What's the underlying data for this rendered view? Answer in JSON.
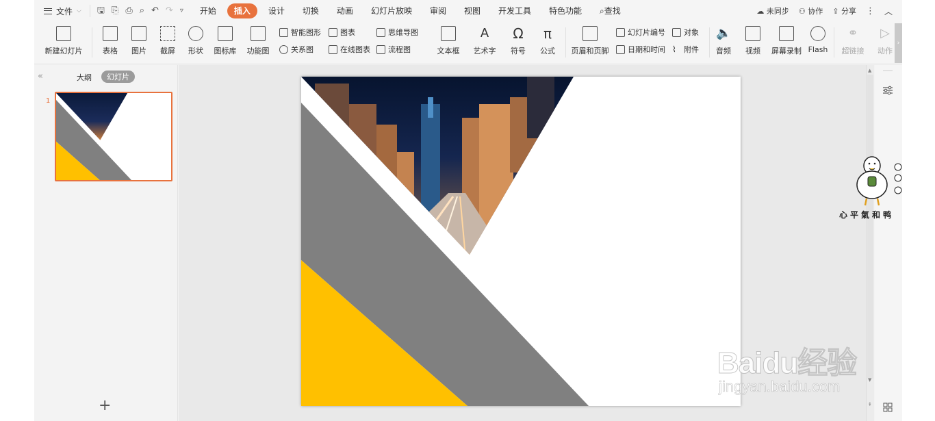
{
  "menubar": {
    "file_label": "文件",
    "tabs": [
      {
        "label": "开始"
      },
      {
        "label": "插入"
      },
      {
        "label": "设计"
      },
      {
        "label": "切换"
      },
      {
        "label": "动画"
      },
      {
        "label": "幻灯片放映"
      },
      {
        "label": "审阅"
      },
      {
        "label": "视图"
      },
      {
        "label": "开发工具"
      },
      {
        "label": "特色功能"
      }
    ],
    "search_label": "查找",
    "sync_label": "未同步",
    "collab_label": "协作",
    "share_label": "分享"
  },
  "ribbon": {
    "new_slide": "新建幻灯片",
    "table": "表格",
    "picture": "图片",
    "screenshot": "截屏",
    "shape": "形状",
    "icon_lib": "图标库",
    "func_chart": "功能图",
    "smart_art": "智能图形",
    "chart": "图表",
    "relation": "关系图",
    "online_chart": "在线图表",
    "mind_map": "思维导图",
    "flow_chart": "流程图",
    "textbox": "文本框",
    "wordart": "艺术字",
    "symbol": "符号",
    "formula": "公式",
    "header_footer": "页眉和页脚",
    "slide_number": "幻灯片编号",
    "object": "对象",
    "datetime": "日期和时间",
    "attachment": "附件",
    "audio": "音频",
    "video": "视频",
    "screen_record": "屏幕录制",
    "flash": "Flash",
    "hyperlink": "超链接",
    "action": "动作"
  },
  "leftpanel": {
    "outline_tab": "大纲",
    "slides_tab": "幻灯片",
    "slide_number": "1",
    "add_symbol": "+"
  },
  "mascot": {
    "caption": "心平氣和鸭"
  },
  "watermark": {
    "main": "Baidu经验",
    "sub": "jingyan.baidu.com"
  },
  "colors": {
    "accent": "#e8723d",
    "slide_gray": "#808080",
    "slide_yellow": "#ffc000"
  }
}
